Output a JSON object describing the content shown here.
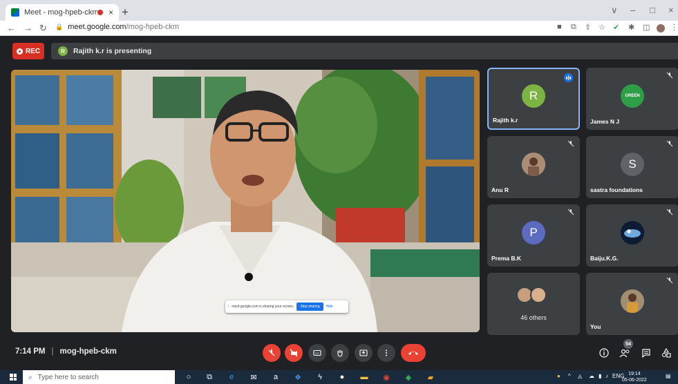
{
  "browser": {
    "tab": {
      "title": "Meet - mog-hpeb-ckm",
      "close": "×",
      "new_tab": "+"
    },
    "window_controls": {
      "dropdown": "∨",
      "minimize": "–",
      "maximize": "□",
      "close": "×"
    },
    "nav": {
      "back": "←",
      "forward": "→",
      "reload": "↻"
    },
    "url": {
      "host": "meet.google.com",
      "path": "/mog-hpeb-ckm"
    }
  },
  "meet": {
    "rec_label": "REC",
    "presenter_initial": "R",
    "presenting_text": "Rajith k.r is presenting",
    "share_notice": {
      "message": "meet.google.com is sharing your screen.",
      "stop": "Stop sharing",
      "hide": "Hide"
    },
    "participants": [
      {
        "name": "Rajith k.r",
        "initial": "R",
        "color": "#7cb342",
        "type": "initial",
        "speaking": true
      },
      {
        "name": "James N J",
        "type": "logo",
        "muted": true
      },
      {
        "name": "Anu R",
        "type": "photo",
        "muted": true
      },
      {
        "name": "sastra foundations",
        "initial": "S",
        "color": "#5f6368",
        "type": "initial",
        "muted": true
      },
      {
        "name": "Prema B.K",
        "initial": "P",
        "color": "#5c6bc0",
        "type": "initial",
        "muted": true
      },
      {
        "name": "Baiju.K.G.",
        "type": "photo",
        "muted": true
      },
      {
        "name": "46 others",
        "type": "group"
      },
      {
        "name": "You",
        "type": "photo",
        "muted": true
      }
    ],
    "time": "7:14 PM",
    "separator": "|",
    "meeting_code": "mog-hpeb-ckm",
    "people_count": "54"
  },
  "taskbar": {
    "search_placeholder": "Type here to search",
    "language": "ENG",
    "time": "19:14",
    "date": "05-06-2022"
  }
}
